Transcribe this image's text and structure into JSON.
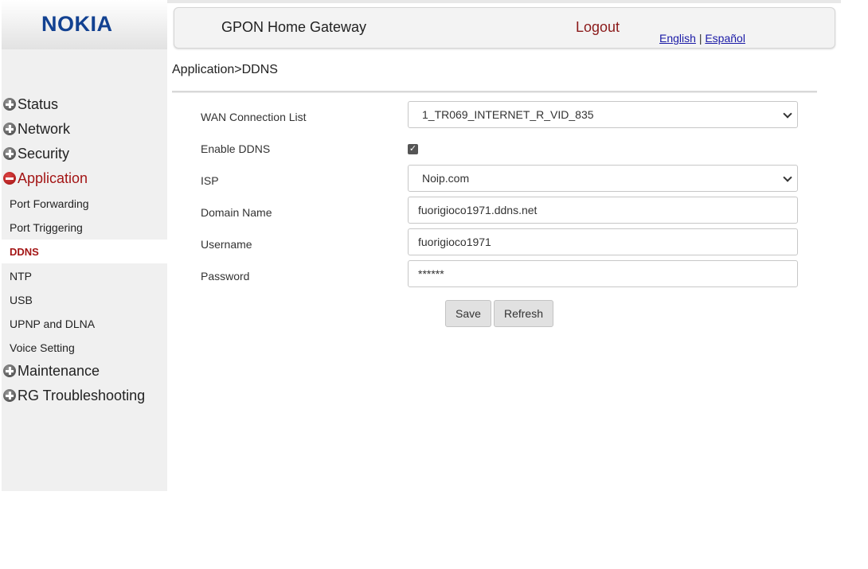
{
  "brand": {
    "logo_text": "NOKIA",
    "logo_color": "#124191"
  },
  "header": {
    "title": "GPON Home Gateway",
    "logout": "Logout",
    "lang_english": "English",
    "lang_separator": "|",
    "lang_spanish": "Español"
  },
  "breadcrumb": "Application>DDNS",
  "sidebar": {
    "status": "Status",
    "network": "Network",
    "security": "Security",
    "application": "Application",
    "sub": {
      "port_forwarding": "Port Forwarding",
      "port_triggering": "Port Triggering",
      "ddns": "DDNS",
      "ntp": "NTP",
      "usb": "USB",
      "upnp": "UPNP and DLNA",
      "voice": "Voice Setting"
    },
    "maintenance": "Maintenance",
    "rg_troubleshooting": "RG Troubleshooting"
  },
  "form": {
    "wan_label": "WAN Connection List",
    "wan_value": "1_TR069_INTERNET_R_VID_835",
    "enable_label": "Enable DDNS",
    "enable_checked": true,
    "enable_check_glyph": "✓",
    "isp_label": "ISP",
    "isp_value": "Noip.com",
    "domain_label": "Domain Name",
    "domain_value": "fuorigioco1971.ddns.net",
    "username_label": "Username",
    "username_value": "fuorigioco1971",
    "password_label": "Password",
    "password_value": "******"
  },
  "buttons": {
    "save": "Save",
    "refresh": "Refresh"
  },
  "colors": {
    "accent_red": "#a31515",
    "sidebar_bg": "#f0f0f0"
  }
}
